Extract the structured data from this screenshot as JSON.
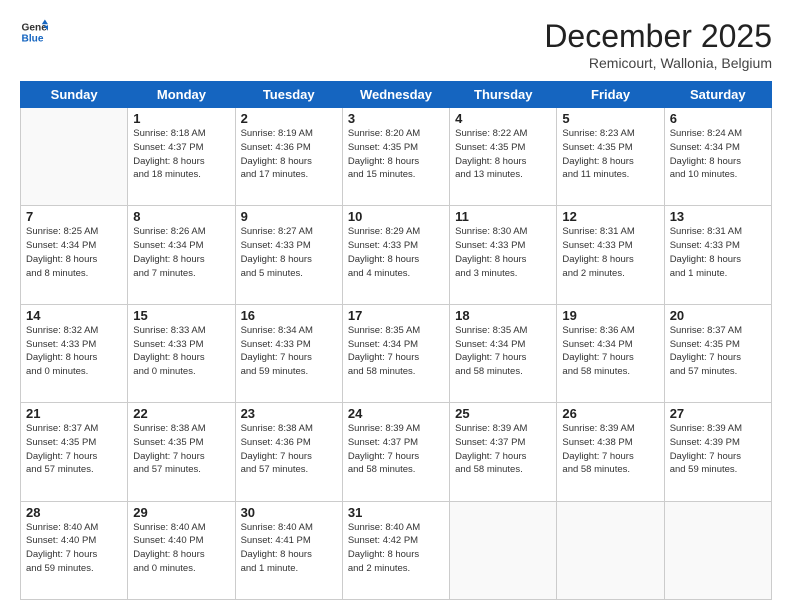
{
  "header": {
    "logo_line1": "General",
    "logo_line2": "Blue",
    "month_title": "December 2025",
    "location": "Remicourt, Wallonia, Belgium"
  },
  "weekdays": [
    "Sunday",
    "Monday",
    "Tuesday",
    "Wednesday",
    "Thursday",
    "Friday",
    "Saturday"
  ],
  "weeks": [
    [
      {
        "day": "",
        "info": ""
      },
      {
        "day": "1",
        "info": "Sunrise: 8:18 AM\nSunset: 4:37 PM\nDaylight: 8 hours\nand 18 minutes."
      },
      {
        "day": "2",
        "info": "Sunrise: 8:19 AM\nSunset: 4:36 PM\nDaylight: 8 hours\nand 17 minutes."
      },
      {
        "day": "3",
        "info": "Sunrise: 8:20 AM\nSunset: 4:35 PM\nDaylight: 8 hours\nand 15 minutes."
      },
      {
        "day": "4",
        "info": "Sunrise: 8:22 AM\nSunset: 4:35 PM\nDaylight: 8 hours\nand 13 minutes."
      },
      {
        "day": "5",
        "info": "Sunrise: 8:23 AM\nSunset: 4:35 PM\nDaylight: 8 hours\nand 11 minutes."
      },
      {
        "day": "6",
        "info": "Sunrise: 8:24 AM\nSunset: 4:34 PM\nDaylight: 8 hours\nand 10 minutes."
      }
    ],
    [
      {
        "day": "7",
        "info": "Sunrise: 8:25 AM\nSunset: 4:34 PM\nDaylight: 8 hours\nand 8 minutes."
      },
      {
        "day": "8",
        "info": "Sunrise: 8:26 AM\nSunset: 4:34 PM\nDaylight: 8 hours\nand 7 minutes."
      },
      {
        "day": "9",
        "info": "Sunrise: 8:27 AM\nSunset: 4:33 PM\nDaylight: 8 hours\nand 5 minutes."
      },
      {
        "day": "10",
        "info": "Sunrise: 8:29 AM\nSunset: 4:33 PM\nDaylight: 8 hours\nand 4 minutes."
      },
      {
        "day": "11",
        "info": "Sunrise: 8:30 AM\nSunset: 4:33 PM\nDaylight: 8 hours\nand 3 minutes."
      },
      {
        "day": "12",
        "info": "Sunrise: 8:31 AM\nSunset: 4:33 PM\nDaylight: 8 hours\nand 2 minutes."
      },
      {
        "day": "13",
        "info": "Sunrise: 8:31 AM\nSunset: 4:33 PM\nDaylight: 8 hours\nand 1 minute."
      }
    ],
    [
      {
        "day": "14",
        "info": "Sunrise: 8:32 AM\nSunset: 4:33 PM\nDaylight: 8 hours\nand 0 minutes."
      },
      {
        "day": "15",
        "info": "Sunrise: 8:33 AM\nSunset: 4:33 PM\nDaylight: 8 hours\nand 0 minutes."
      },
      {
        "day": "16",
        "info": "Sunrise: 8:34 AM\nSunset: 4:33 PM\nDaylight: 7 hours\nand 59 minutes."
      },
      {
        "day": "17",
        "info": "Sunrise: 8:35 AM\nSunset: 4:34 PM\nDaylight: 7 hours\nand 58 minutes."
      },
      {
        "day": "18",
        "info": "Sunrise: 8:35 AM\nSunset: 4:34 PM\nDaylight: 7 hours\nand 58 minutes."
      },
      {
        "day": "19",
        "info": "Sunrise: 8:36 AM\nSunset: 4:34 PM\nDaylight: 7 hours\nand 58 minutes."
      },
      {
        "day": "20",
        "info": "Sunrise: 8:37 AM\nSunset: 4:35 PM\nDaylight: 7 hours\nand 57 minutes."
      }
    ],
    [
      {
        "day": "21",
        "info": "Sunrise: 8:37 AM\nSunset: 4:35 PM\nDaylight: 7 hours\nand 57 minutes."
      },
      {
        "day": "22",
        "info": "Sunrise: 8:38 AM\nSunset: 4:35 PM\nDaylight: 7 hours\nand 57 minutes."
      },
      {
        "day": "23",
        "info": "Sunrise: 8:38 AM\nSunset: 4:36 PM\nDaylight: 7 hours\nand 57 minutes."
      },
      {
        "day": "24",
        "info": "Sunrise: 8:39 AM\nSunset: 4:37 PM\nDaylight: 7 hours\nand 58 minutes."
      },
      {
        "day": "25",
        "info": "Sunrise: 8:39 AM\nSunset: 4:37 PM\nDaylight: 7 hours\nand 58 minutes."
      },
      {
        "day": "26",
        "info": "Sunrise: 8:39 AM\nSunset: 4:38 PM\nDaylight: 7 hours\nand 58 minutes."
      },
      {
        "day": "27",
        "info": "Sunrise: 8:39 AM\nSunset: 4:39 PM\nDaylight: 7 hours\nand 59 minutes."
      }
    ],
    [
      {
        "day": "28",
        "info": "Sunrise: 8:40 AM\nSunset: 4:40 PM\nDaylight: 7 hours\nand 59 minutes."
      },
      {
        "day": "29",
        "info": "Sunrise: 8:40 AM\nSunset: 4:40 PM\nDaylight: 8 hours\nand 0 minutes."
      },
      {
        "day": "30",
        "info": "Sunrise: 8:40 AM\nSunset: 4:41 PM\nDaylight: 8 hours\nand 1 minute."
      },
      {
        "day": "31",
        "info": "Sunrise: 8:40 AM\nSunset: 4:42 PM\nDaylight: 8 hours\nand 2 minutes."
      },
      {
        "day": "",
        "info": ""
      },
      {
        "day": "",
        "info": ""
      },
      {
        "day": "",
        "info": ""
      }
    ]
  ]
}
